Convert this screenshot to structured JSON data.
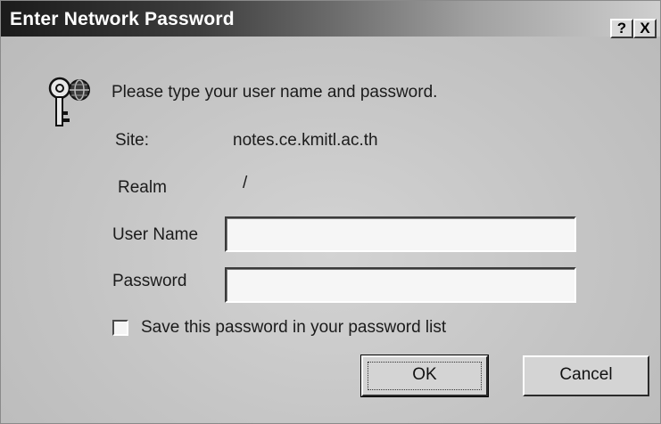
{
  "dialog": {
    "title": "Enter Network Password",
    "help_glyph": "?",
    "close_glyph": "X",
    "prompt": "Please type your user name and password.",
    "site_label": "Site:",
    "site_value": "notes.ce.kmitl.ac.th",
    "realm_label": "Realm",
    "realm_value": "/",
    "username_label": "User Name",
    "username_value": "",
    "password_label": "Password",
    "password_value": "",
    "save_password_label": "Save this password in your password list",
    "save_password_checked": false,
    "ok_label": "OK",
    "cancel_label": "Cancel",
    "icons": {
      "dialog_icon": "key-with-globe-icon",
      "help": "help-icon",
      "close": "close-icon"
    }
  }
}
